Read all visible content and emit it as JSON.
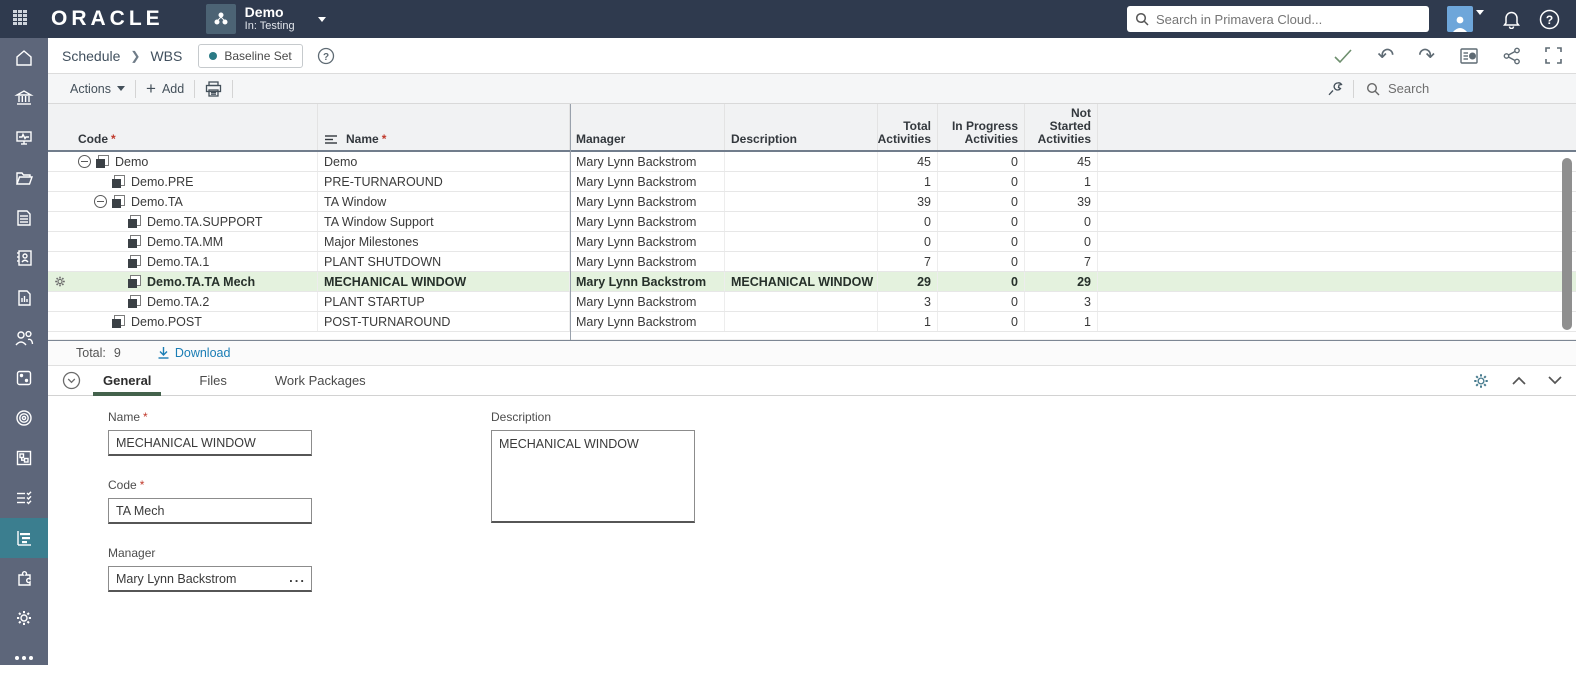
{
  "topbar": {
    "brand": "ORACLE",
    "project": {
      "name": "Demo",
      "context": "In: Testing"
    },
    "search_placeholder": "Search in Primavera Cloud...",
    "icons": [
      "app-launcher-icon",
      "project-icon",
      "search-icon",
      "avatar-icon",
      "notifications-bell-icon",
      "help-icon"
    ]
  },
  "sidebar": {
    "active_item": "schedule-wbs",
    "icons": [
      "home-icon",
      "portfolio-icon",
      "dashboard-icon",
      "files-icon",
      "document-icon",
      "contacts-icon",
      "reports-icon",
      "resources-icon",
      "risk-icon",
      "objectives-icon",
      "workflow-icon",
      "tasks-icon",
      "schedule-wbs-icon",
      "apps-icon",
      "settings-icon",
      "more-icon"
    ]
  },
  "breadcrumb": {
    "items": [
      "Schedule",
      "WBS"
    ],
    "baseline_label": "Baseline Set",
    "right_icons": [
      "check-icon",
      "undo-icon",
      "redo-icon",
      "report-view-icon",
      "share-icon",
      "fullscreen-icon"
    ],
    "undo_glyph": "↶",
    "redo_glyph": "↷"
  },
  "toolbar": {
    "actions_label": "Actions",
    "add_label": "Add",
    "icons": [
      "print-icon",
      "wrench-icon",
      "search-icon"
    ],
    "search_placeholder": "Search"
  },
  "table": {
    "required_marker": "*",
    "columns": {
      "code": "Code",
      "name": "Name",
      "manager": "Manager",
      "description": "Description",
      "total": "Total Activities",
      "in_progress": "In Progress Activities",
      "not_started": "Not Started Activities"
    },
    "rows": [
      {
        "code": "Demo",
        "name": "Demo",
        "manager": "Mary Lynn Backstrom",
        "description": "",
        "total": "45",
        "in_progress": "0",
        "not_started": "45",
        "level": 1,
        "has_children": true,
        "selected": false
      },
      {
        "code": "Demo.PRE",
        "name": "PRE-TURNAROUND",
        "manager": "Mary Lynn Backstrom",
        "description": "",
        "total": "1",
        "in_progress": "0",
        "not_started": "1",
        "level": 2,
        "has_children": false,
        "selected": false
      },
      {
        "code": "Demo.TA",
        "name": "TA Window",
        "manager": "Mary Lynn Backstrom",
        "description": "",
        "total": "39",
        "in_progress": "0",
        "not_started": "39",
        "level": 2,
        "has_children": true,
        "selected": false
      },
      {
        "code": "Demo.TA.SUPPORT",
        "name": "TA Window Support",
        "manager": "Mary Lynn Backstrom",
        "description": "",
        "total": "0",
        "in_progress": "0",
        "not_started": "0",
        "level": 3,
        "has_children": false,
        "selected": false
      },
      {
        "code": "Demo.TA.MM",
        "name": "Major Milestones",
        "manager": "Mary Lynn Backstrom",
        "description": "",
        "total": "0",
        "in_progress": "0",
        "not_started": "0",
        "level": 3,
        "has_children": false,
        "selected": false
      },
      {
        "code": "Demo.TA.1",
        "name": "PLANT SHUTDOWN",
        "manager": "Mary Lynn Backstrom",
        "description": "",
        "total": "7",
        "in_progress": "0",
        "not_started": "7",
        "level": 3,
        "has_children": false,
        "selected": false
      },
      {
        "code": "Demo.TA.TA Mech",
        "name": "MECHANICAL WINDOW",
        "manager": "Mary Lynn Backstrom",
        "description": "MECHANICAL WINDOW",
        "total": "29",
        "in_progress": "0",
        "not_started": "29",
        "level": 3,
        "has_children": false,
        "selected": true
      },
      {
        "code": "Demo.TA.2",
        "name": "PLANT STARTUP",
        "manager": "Mary Lynn Backstrom",
        "description": "",
        "total": "3",
        "in_progress": "0",
        "not_started": "3",
        "level": 3,
        "has_children": false,
        "selected": false
      },
      {
        "code": "Demo.POST",
        "name": "POST-TURNAROUND",
        "manager": "Mary Lynn Backstrom",
        "description": "",
        "total": "1",
        "in_progress": "0",
        "not_started": "1",
        "level": 2,
        "has_children": false,
        "selected": false
      }
    ],
    "total_label": "Total:",
    "total_value": "9",
    "download_label": "Download"
  },
  "tabs": {
    "items": [
      "General",
      "Files",
      "Work Packages"
    ],
    "active": "General",
    "right_icons": [
      "gear-icon",
      "collapse-up-icon",
      "collapse-down-icon"
    ]
  },
  "form": {
    "name": {
      "label": "Name",
      "required": true,
      "value": "MECHANICAL WINDOW"
    },
    "code": {
      "label": "Code",
      "required": true,
      "value": "TA Mech"
    },
    "manager": {
      "label": "Manager",
      "value": "Mary Lynn Backstrom",
      "more_glyph": "..."
    },
    "description": {
      "label": "Description",
      "value": "MECHANICAL WINDOW"
    }
  },
  "colors": {
    "topbar": "#2f3a4e",
    "sidebar": "#5d667a",
    "sidebar_active": "#3b7e8f",
    "selected_row": "#e4f2de",
    "tab_underline": "#44624c",
    "link": "#1a7db5",
    "baseline_dot": "#2a7a85",
    "required": "#c0392b",
    "avatar": "#6ea6da"
  }
}
